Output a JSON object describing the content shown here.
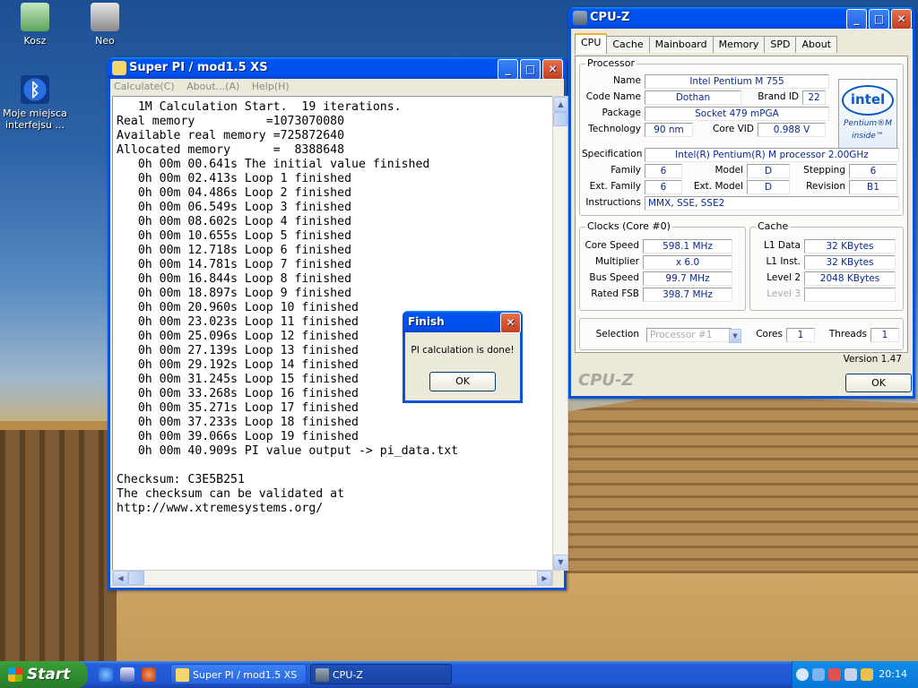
{
  "desktop": {
    "icons": [
      {
        "label": "Kosz"
      },
      {
        "label": "Neo"
      },
      {
        "label": "Moje miejsca interfejsu ..."
      }
    ]
  },
  "superpi": {
    "title": "Super PI / mod1.5 XS",
    "menu": [
      "Calculate(C)",
      "About...(A)",
      "Help(H)"
    ],
    "console_text": "   1M Calculation Start.  19 iterations.\nReal memory          =1073070080\nAvailable real memory =725872640\nAllocated memory      =  8388648\n   0h 00m 00.641s The initial value finished\n   0h 00m 02.413s Loop 1 finished\n   0h 00m 04.486s Loop 2 finished\n   0h 00m 06.549s Loop 3 finished\n   0h 00m 08.602s Loop 4 finished\n   0h 00m 10.655s Loop 5 finished\n   0h 00m 12.718s Loop 6 finished\n   0h 00m 14.781s Loop 7 finished\n   0h 00m 16.844s Loop 8 finished\n   0h 00m 18.897s Loop 9 finished\n   0h 00m 20.960s Loop 10 finished\n   0h 00m 23.023s Loop 11 finished\n   0h 00m 25.096s Loop 12 finished\n   0h 00m 27.139s Loop 13 finished\n   0h 00m 29.192s Loop 14 finished\n   0h 00m 31.245s Loop 15 finished\n   0h 00m 33.268s Loop 16 finished\n   0h 00m 35.271s Loop 17 finished\n   0h 00m 37.233s Loop 18 finished\n   0h 00m 39.066s Loop 19 finished\n   0h 00m 40.909s PI value output -> pi_data.txt\n\nChecksum: C3E5B251\nThe checksum can be validated at\nhttp://www.xtremesystems.org/"
  },
  "dialog": {
    "title": "Finish",
    "message": "PI calculation is done!",
    "ok": "OK"
  },
  "cpuz": {
    "title": "CPU-Z",
    "tabs": [
      "CPU",
      "Cache",
      "Mainboard",
      "Memory",
      "SPD",
      "About"
    ],
    "processor": {
      "group": "Processor",
      "name_label": "Name",
      "name": "Intel Pentium M 755",
      "codename_label": "Code Name",
      "codename": "Dothan",
      "brandid_label": "Brand ID",
      "brandid": "22",
      "package_label": "Package",
      "package": "Socket 479 mPGA",
      "tech_label": "Technology",
      "tech": "90 nm",
      "vid_label": "Core VID",
      "vid": "0.988 V",
      "spec_label": "Specification",
      "spec": "Intel(R) Pentium(R) M processor 2.00GHz",
      "family_label": "Family",
      "family": "6",
      "model_label": "Model",
      "model": "D",
      "stepping_label": "Stepping",
      "stepping": "6",
      "extfamily_label": "Ext. Family",
      "extfamily": "6",
      "extmodel_label": "Ext. Model",
      "extmodel": "D",
      "revision_label": "Revision",
      "revision": "B1",
      "instr_label": "Instructions",
      "instr": "MMX, SSE, SSE2",
      "logo_brand": "intel",
      "logo_line1": "Pentium®M",
      "logo_line2": "inside™"
    },
    "clocks": {
      "group": "Clocks (Core #0)",
      "speed_label": "Core Speed",
      "speed": "598.1 MHz",
      "mult_label": "Multiplier",
      "mult": "x 6.0",
      "bus_label": "Bus Speed",
      "bus": "99.7 MHz",
      "fsb_label": "Rated FSB",
      "fsb": "398.7 MHz"
    },
    "cache": {
      "group": "Cache",
      "l1d_label": "L1 Data",
      "l1d": "32 KBytes",
      "l1i_label": "L1 Inst.",
      "l1i": "32 KBytes",
      "l2_label": "Level 2",
      "l2": "2048 KBytes",
      "l3_label": "Level 3",
      "l3": ""
    },
    "selection_label": "Selection",
    "selection": "Processor #1",
    "cores_label": "Cores",
    "cores": "1",
    "threads_label": "Threads",
    "threads": "1",
    "version": "Version 1.47",
    "brand_footer": "CPU-Z",
    "ok": "OK"
  },
  "taskbar": {
    "start": "Start",
    "tasks": [
      "Super PI / mod1.5 XS",
      "CPU-Z"
    ],
    "clock": "20:14"
  }
}
